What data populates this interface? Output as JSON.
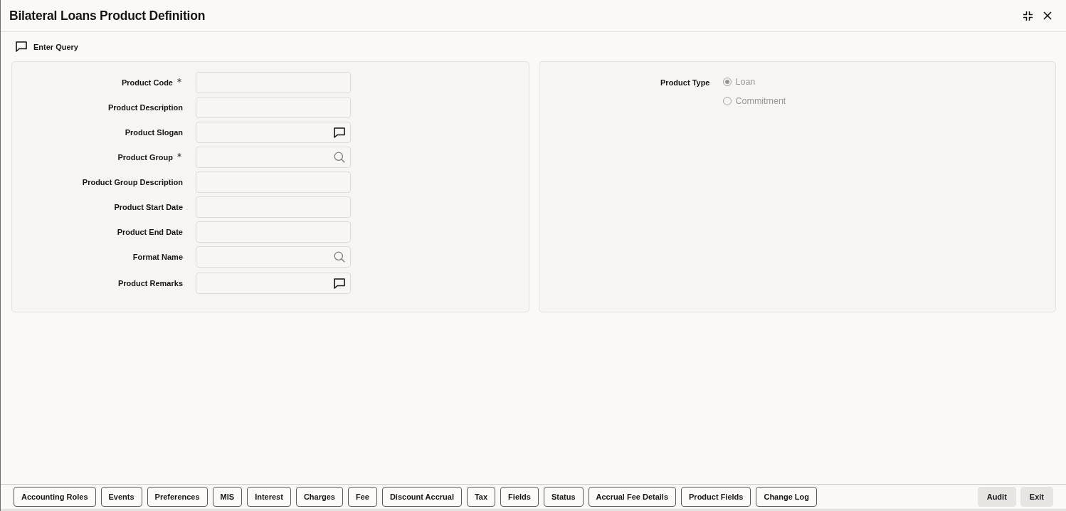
{
  "window": {
    "title": "Bilateral Loans Product Definition"
  },
  "toolbar": {
    "enter_query": {
      "label": "Enter Query"
    }
  },
  "form": {
    "fields": [
      {
        "label": "Product Code",
        "required": true,
        "kind": "text"
      },
      {
        "label": "Product Description",
        "required": false,
        "kind": "text"
      },
      {
        "label": "Product Slogan",
        "required": false,
        "kind": "note"
      },
      {
        "label": "Product Group",
        "required": true,
        "kind": "lookup"
      },
      {
        "label": "Product Group Description",
        "required": false,
        "kind": "text"
      },
      {
        "label": "Product Start Date",
        "required": false,
        "kind": "text"
      },
      {
        "label": "Product End Date",
        "required": false,
        "kind": "text"
      },
      {
        "label": "Format Name",
        "required": false,
        "kind": "lookup"
      },
      {
        "label": "Product Remarks",
        "required": false,
        "kind": "note"
      }
    ]
  },
  "product_type": {
    "label": "Product Type",
    "options": [
      {
        "label": "Loan",
        "selected": true,
        "disabled": true
      },
      {
        "label": "Commitment",
        "selected": false,
        "disabled": true
      }
    ]
  },
  "footer": {
    "buttons": [
      "Accounting Roles",
      "Events",
      "Preferences",
      "MIS",
      "Interest",
      "Charges",
      "Fee",
      "Discount Accrual",
      "Tax",
      "Fields",
      "Status",
      "Accrual Fee Details",
      "Product Fields",
      "Change Log"
    ],
    "actions": [
      "Audit",
      "Exit"
    ]
  }
}
